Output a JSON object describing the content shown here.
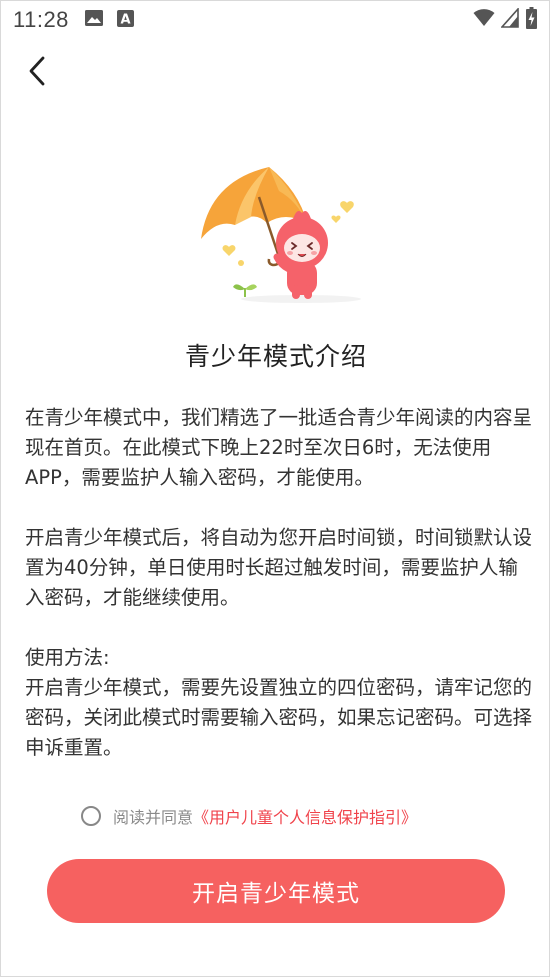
{
  "status_bar": {
    "time": "11:28",
    "icons": [
      "image-icon",
      "a-letter-icon",
      "wifi-icon",
      "signal-icon",
      "battery-charging-icon"
    ]
  },
  "nav": {
    "back_icon": "chevron-left-icon"
  },
  "illustration": {
    "name": "umbrella-mascot-illustration",
    "colors": {
      "umbrella": "#f6a43a",
      "mascot": "#f5626a",
      "hearts": "#f8d56b"
    }
  },
  "title": "青少年模式介绍",
  "paragraphs": [
    "在青少年模式中，我们精选了一批适合青少年阅读的内容呈现在首页。在此模式下晚上22时至次日6时，无法使用APP，需要监护人输入密码，才能使用。",
    "开启青少年模式后，将自动为您开启时间锁，时间锁默认设置为40分钟，单日使用时长超过触发时间，需要监护人输入密码，才能继续使用。"
  ],
  "usage": {
    "heading": "使用方法:",
    "text": "开启青少年模式，需要先设置独立的四位密码，请牢记您的密码，关闭此模式时需要输入密码，如果忘记密码。可选择申诉重置。"
  },
  "agreement": {
    "checked": false,
    "prefix": "阅读并同意",
    "link": "《用户儿童个人信息保护指引》"
  },
  "cta": {
    "label": "开启青少年模式"
  },
  "colors": {
    "accent": "#f66160",
    "link": "#f0434b",
    "text": "#333333",
    "muted": "#8a8a8a"
  }
}
